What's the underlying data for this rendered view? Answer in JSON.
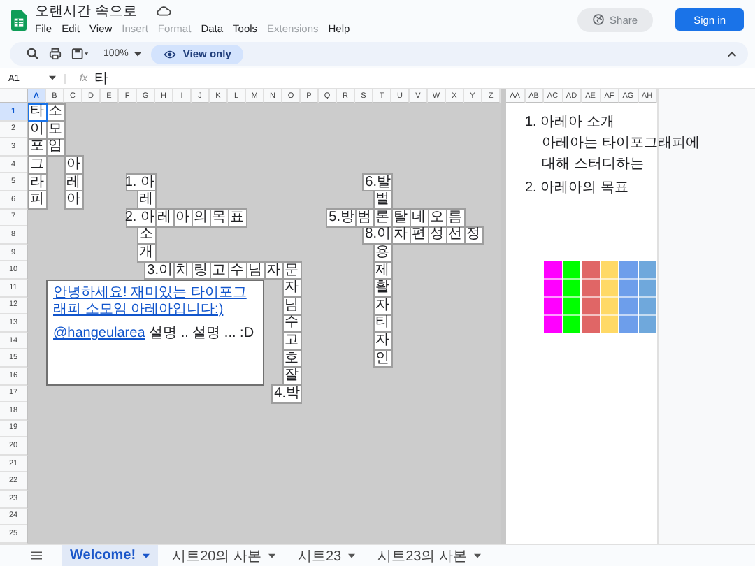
{
  "app": {
    "title": "오랜시간 속으로",
    "share": "Share",
    "sign_in": "Sign in"
  },
  "menus": [
    {
      "label": "File",
      "disabled": false
    },
    {
      "label": "Edit",
      "disabled": false
    },
    {
      "label": "View",
      "disabled": false
    },
    {
      "label": "Insert",
      "disabled": true
    },
    {
      "label": "Format",
      "disabled": true
    },
    {
      "label": "Data",
      "disabled": false
    },
    {
      "label": "Tools",
      "disabled": false
    },
    {
      "label": "Extensions",
      "disabled": true
    },
    {
      "label": "Help",
      "disabled": false
    }
  ],
  "toolbar": {
    "zoom": "100%",
    "view_only": "View only"
  },
  "formula_bar": {
    "cell": "A1",
    "function_label": "fx",
    "value": "타"
  },
  "columns": [
    {
      "label": "A",
      "selected": true
    },
    {
      "label": "B",
      "selected": false
    },
    {
      "label": "C",
      "selected": false
    },
    {
      "label": "D",
      "selected": false
    },
    {
      "label": "E",
      "selected": false
    },
    {
      "label": "F",
      "selected": false
    },
    {
      "label": "G",
      "selected": false
    },
    {
      "label": "H",
      "selected": false
    },
    {
      "label": "I",
      "selected": false
    },
    {
      "label": "J",
      "selected": false
    },
    {
      "label": "K",
      "selected": false
    },
    {
      "label": "L",
      "selected": false
    },
    {
      "label": "M",
      "selected": false
    },
    {
      "label": "N",
      "selected": false
    },
    {
      "label": "O",
      "selected": false
    },
    {
      "label": "P",
      "selected": false
    },
    {
      "label": "Q",
      "selected": false
    },
    {
      "label": "R",
      "selected": false
    },
    {
      "label": "S",
      "selected": false
    },
    {
      "label": "T",
      "selected": false
    },
    {
      "label": "U",
      "selected": false
    },
    {
      "label": "V",
      "selected": false
    },
    {
      "label": "W",
      "selected": false
    },
    {
      "label": "X",
      "selected": false
    },
    {
      "label": "Y",
      "selected": false
    },
    {
      "label": "Z",
      "selected": false
    },
    {
      "label": "AA",
      "selected": false
    },
    {
      "label": "AB",
      "selected": false
    },
    {
      "label": "AC",
      "selected": false
    },
    {
      "label": "AD",
      "selected": false
    },
    {
      "label": "AE",
      "selected": false
    },
    {
      "label": "AF",
      "selected": false
    },
    {
      "label": "AG",
      "selected": false
    },
    {
      "label": "AH",
      "selected": false
    }
  ],
  "rows": [
    {
      "label": "1",
      "selected": true
    },
    {
      "label": "2",
      "selected": false
    },
    {
      "label": "3",
      "selected": false
    },
    {
      "label": "4",
      "selected": false
    },
    {
      "label": "5",
      "selected": false
    },
    {
      "label": "6",
      "selected": false
    },
    {
      "label": "7",
      "selected": false
    },
    {
      "label": "8",
      "selected": false
    },
    {
      "label": "9",
      "selected": false
    },
    {
      "label": "10",
      "selected": false
    },
    {
      "label": "11",
      "selected": false
    },
    {
      "label": "12",
      "selected": false
    },
    {
      "label": "13",
      "selected": false
    },
    {
      "label": "14",
      "selected": false
    },
    {
      "label": "15",
      "selected": false
    },
    {
      "label": "16",
      "selected": false
    },
    {
      "label": "17",
      "selected": false
    },
    {
      "label": "18",
      "selected": false
    },
    {
      "label": "19",
      "selected": false
    },
    {
      "label": "20",
      "selected": false
    },
    {
      "label": "21",
      "selected": false
    },
    {
      "label": "22",
      "selected": false
    },
    {
      "label": "23",
      "selected": false
    },
    {
      "label": "24",
      "selected": false
    },
    {
      "label": "25",
      "selected": false
    }
  ],
  "cells": [
    {
      "text": "타",
      "selected": true
    },
    {
      "text": "소",
      "selected": false
    },
    {
      "text": "이",
      "selected": false
    },
    {
      "text": "모",
      "selected": false
    },
    {
      "text": "포",
      "selected": false
    },
    {
      "text": "임",
      "selected": false
    },
    {
      "text": "그",
      "selected": false
    },
    {
      "text": "아",
      "selected": false
    },
    {
      "text": "라",
      "selected": false
    },
    {
      "text": "레",
      "selected": false
    },
    {
      "text": "1. 아",
      "selected": false
    },
    {
      "text": "6.발",
      "selected": false
    },
    {
      "text": "피",
      "selected": false
    },
    {
      "text": "아",
      "selected": false
    },
    {
      "text": "레",
      "selected": false
    },
    {
      "text": "벌",
      "selected": false
    },
    {
      "text": "2. 아",
      "selected": false
    },
    {
      "text": "레",
      "selected": false
    },
    {
      "text": "아",
      "selected": false
    },
    {
      "text": "의",
      "selected": false
    },
    {
      "text": "목",
      "selected": false
    },
    {
      "text": "표",
      "selected": false
    },
    {
      "text": "5.방",
      "selected": false
    },
    {
      "text": "범",
      "selected": false
    },
    {
      "text": "론",
      "selected": false
    },
    {
      "text": "탈",
      "selected": false
    },
    {
      "text": "네",
      "selected": false
    },
    {
      "text": "오",
      "selected": false
    },
    {
      "text": "름",
      "selected": false
    },
    {
      "text": "소",
      "selected": false
    },
    {
      "text": "8.이",
      "selected": false
    },
    {
      "text": "차",
      "selected": false
    },
    {
      "text": "편",
      "selected": false
    },
    {
      "text": "성",
      "selected": false
    },
    {
      "text": "선",
      "selected": false
    },
    {
      "text": "정",
      "selected": false
    },
    {
      "text": "개",
      "selected": false
    },
    {
      "text": "용",
      "selected": false
    },
    {
      "text": "3.이",
      "selected": false
    },
    {
      "text": "치",
      "selected": false
    },
    {
      "text": "링",
      "selected": false
    },
    {
      "text": "고",
      "selected": false
    },
    {
      "text": "수",
      "selected": false
    },
    {
      "text": "님",
      "selected": false
    },
    {
      "text": "자",
      "selected": false
    },
    {
      "text": "문",
      "selected": false
    },
    {
      "text": "제",
      "selected": false
    },
    {
      "text": "자",
      "selected": false
    },
    {
      "text": "활",
      "selected": false
    },
    {
      "text": "님",
      "selected": false
    },
    {
      "text": "자",
      "selected": false
    },
    {
      "text": "수",
      "selected": false
    },
    {
      "text": "티",
      "selected": false
    },
    {
      "text": "고",
      "selected": false
    },
    {
      "text": "자",
      "selected": false
    },
    {
      "text": "호",
      "selected": false
    },
    {
      "text": "인",
      "selected": false
    },
    {
      "text": "잘",
      "selected": false
    },
    {
      "text": "4.박",
      "selected": false
    }
  ],
  "text_box": {
    "link": "안녕하세요! 재미있는 타이포그래피 소모임 아레아입니다:)",
    "mention": "@hangeularea",
    "text": " 설명 .. 설명 ... :D"
  },
  "notes": [
    {
      "title": "1. 아레아 소개",
      "lines": [
        "아레아는 타이포그래피에",
        "대해 스터디하는"
      ]
    },
    {
      "title": "2. 아레아의 목표"
    }
  ],
  "swatches": [
    {
      "color": "#ff00ff"
    },
    {
      "color": "#00ff00"
    },
    {
      "color": "#e06666"
    },
    {
      "color": "#ffd966"
    },
    {
      "color": "#6d9eeb"
    },
    {
      "color": "#6fa8dc"
    }
  ],
  "sheet_tabs": [
    {
      "label": "Welcome!",
      "selected": true
    },
    {
      "label": "시트20의 사본",
      "selected": false
    },
    {
      "label": "시트23",
      "selected": false
    },
    {
      "label": "시트23의 사본",
      "selected": false
    }
  ]
}
